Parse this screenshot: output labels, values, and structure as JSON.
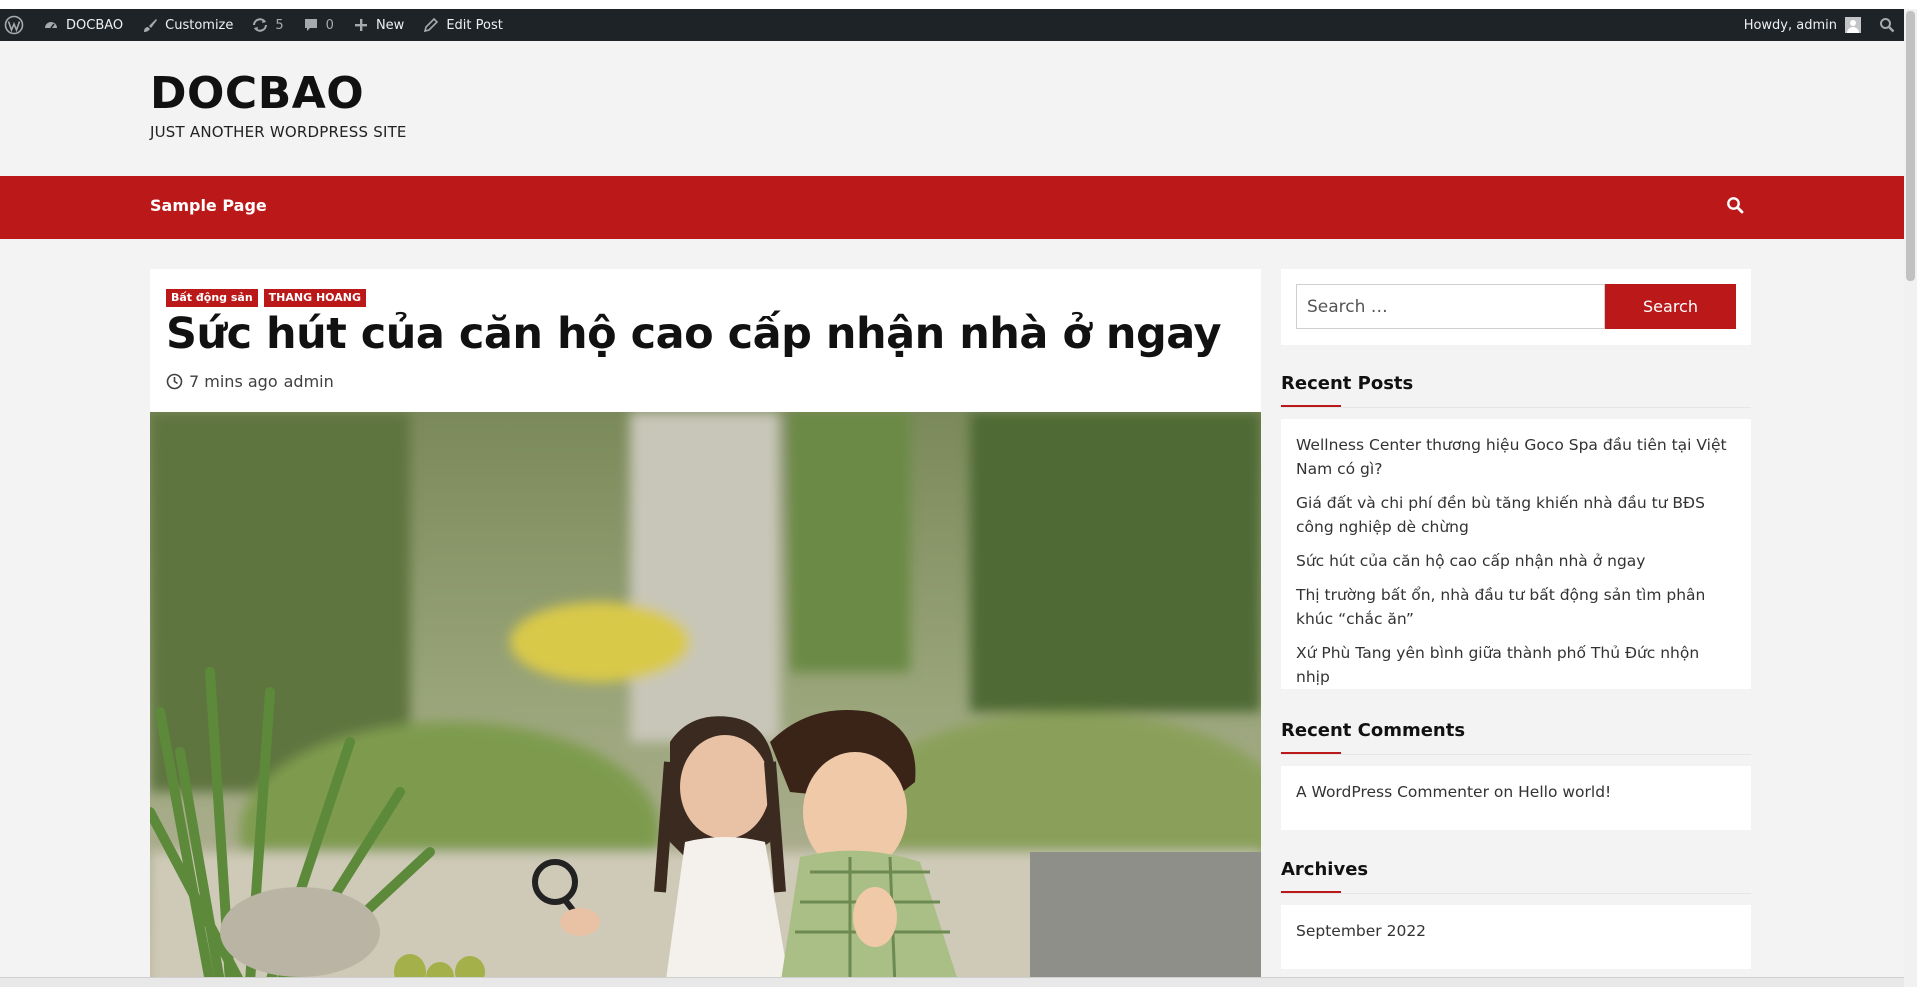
{
  "admin_bar": {
    "site_name": "DOCBAO",
    "customize": "Customize",
    "updates_count": "5",
    "comments_count": "0",
    "new_label": "New",
    "edit_post": "Edit Post",
    "howdy": "Howdy, admin"
  },
  "site": {
    "title": "DOCBAO",
    "tagline": "JUST ANOTHER WORDPRESS SITE"
  },
  "nav": {
    "items": [
      "Sample Page"
    ]
  },
  "post": {
    "categories": [
      "Bất động sản",
      "THANG HOANG"
    ],
    "title": "Sức hút của căn hộ cao cấp nhận nhà ở ngay",
    "time_ago": "7 mins ago",
    "author": "admin"
  },
  "sidebar": {
    "search_placeholder": "Search …",
    "search_button": "Search",
    "recent_posts_title": "Recent Posts",
    "recent_posts": [
      "Wellness Center thương hiệu Goco Spa đầu tiên tại Việt Nam có gì?",
      "Giá đất và chi phí đền bù tăng khiến nhà đầu tư BĐS công nghiệp dè chừng",
      "Sức hút của căn hộ cao cấp nhận nhà ở ngay",
      "Thị trường bất ổn, nhà đầu tư bất động sản tìm phân khúc “chắc ăn”",
      "Xứ Phù Tang yên bình giữa thành phố Thủ Đức nhộn nhịp"
    ],
    "recent_comments_title": "Recent Comments",
    "comment_author": "A WordPress Commenter",
    "comment_on": "on",
    "comment_post": "Hello world!",
    "archives_title": "Archives",
    "archives": [
      "September 2022"
    ]
  },
  "colors": {
    "accent": "#bb1919",
    "admin_bar": "#1d2327"
  }
}
